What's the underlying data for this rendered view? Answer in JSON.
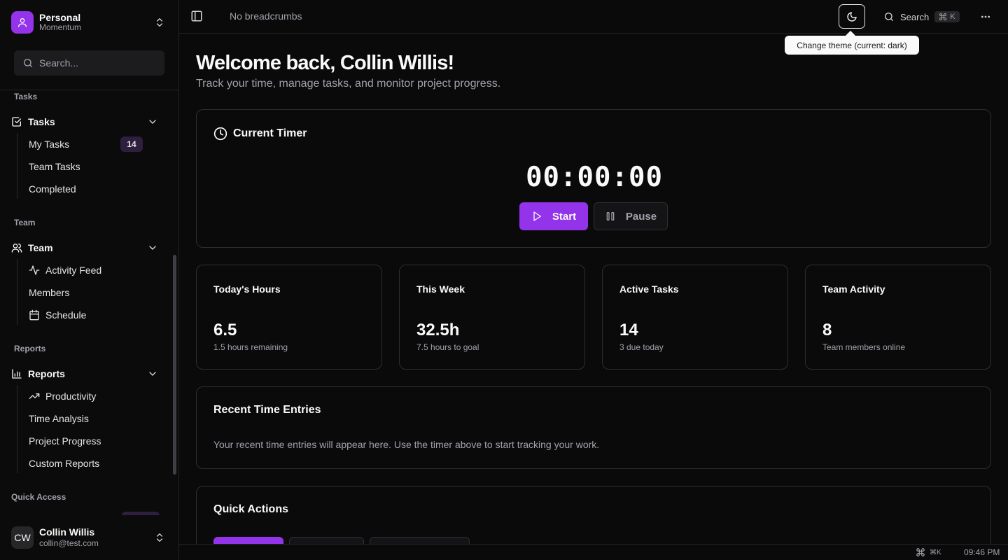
{
  "workspace": {
    "name": "Personal",
    "subtitle": "Momentum"
  },
  "sidebar": {
    "search_placeholder": "Search...",
    "groups": [
      {
        "label": "Tasks",
        "head": "Tasks",
        "items": [
          {
            "label": "My Tasks",
            "badge": "14"
          },
          {
            "label": "Team Tasks"
          },
          {
            "label": "Completed"
          }
        ]
      },
      {
        "label": "Team",
        "head": "Team",
        "items": [
          {
            "label": "Activity Feed"
          },
          {
            "label": "Members"
          },
          {
            "label": "Schedule"
          }
        ]
      },
      {
        "label": "Reports",
        "head": "Reports",
        "items": [
          {
            "label": "Productivity"
          },
          {
            "label": "Time Analysis"
          },
          {
            "label": "Project Progress"
          },
          {
            "label": "Custom Reports"
          }
        ]
      }
    ],
    "quick_access_label": "Quick Access"
  },
  "user": {
    "initials": "CW",
    "name": "Collin Willis",
    "email": "collin@test.com"
  },
  "topbar": {
    "breadcrumbs": "No breadcrumbs",
    "search_label": "Search",
    "search_shortcut": "K",
    "theme_tooltip": "Change theme (current: dark)"
  },
  "main": {
    "welcome": "Welcome back, Collin Willis!",
    "welcome_sub": "Track your time, manage tasks, and monitor project progress.",
    "timer": {
      "title": "Current Timer",
      "display": "00:00:00",
      "start_label": "Start",
      "pause_label": "Pause"
    },
    "stats": [
      {
        "label": "Today's Hours",
        "value": "6.5",
        "sub": "1.5 hours remaining"
      },
      {
        "label": "This Week",
        "value": "32.5h",
        "sub": "7.5 hours to goal"
      },
      {
        "label": "Active Tasks",
        "value": "14",
        "sub": "3 due today"
      },
      {
        "label": "Team Activity",
        "value": "8",
        "sub": "Team members online"
      }
    ],
    "recent": {
      "title": "Recent Time Entries",
      "text": "Your recent time entries will appear here. Use the timer above to start tracking your work."
    },
    "quick_actions": {
      "title": "Quick Actions"
    }
  },
  "statusbar": {
    "shortcut": "⌘K",
    "time": "09:46 PM"
  },
  "colors": {
    "accent": "#9333ea",
    "background": "#0a0a0b",
    "border": "#2e2e33"
  }
}
